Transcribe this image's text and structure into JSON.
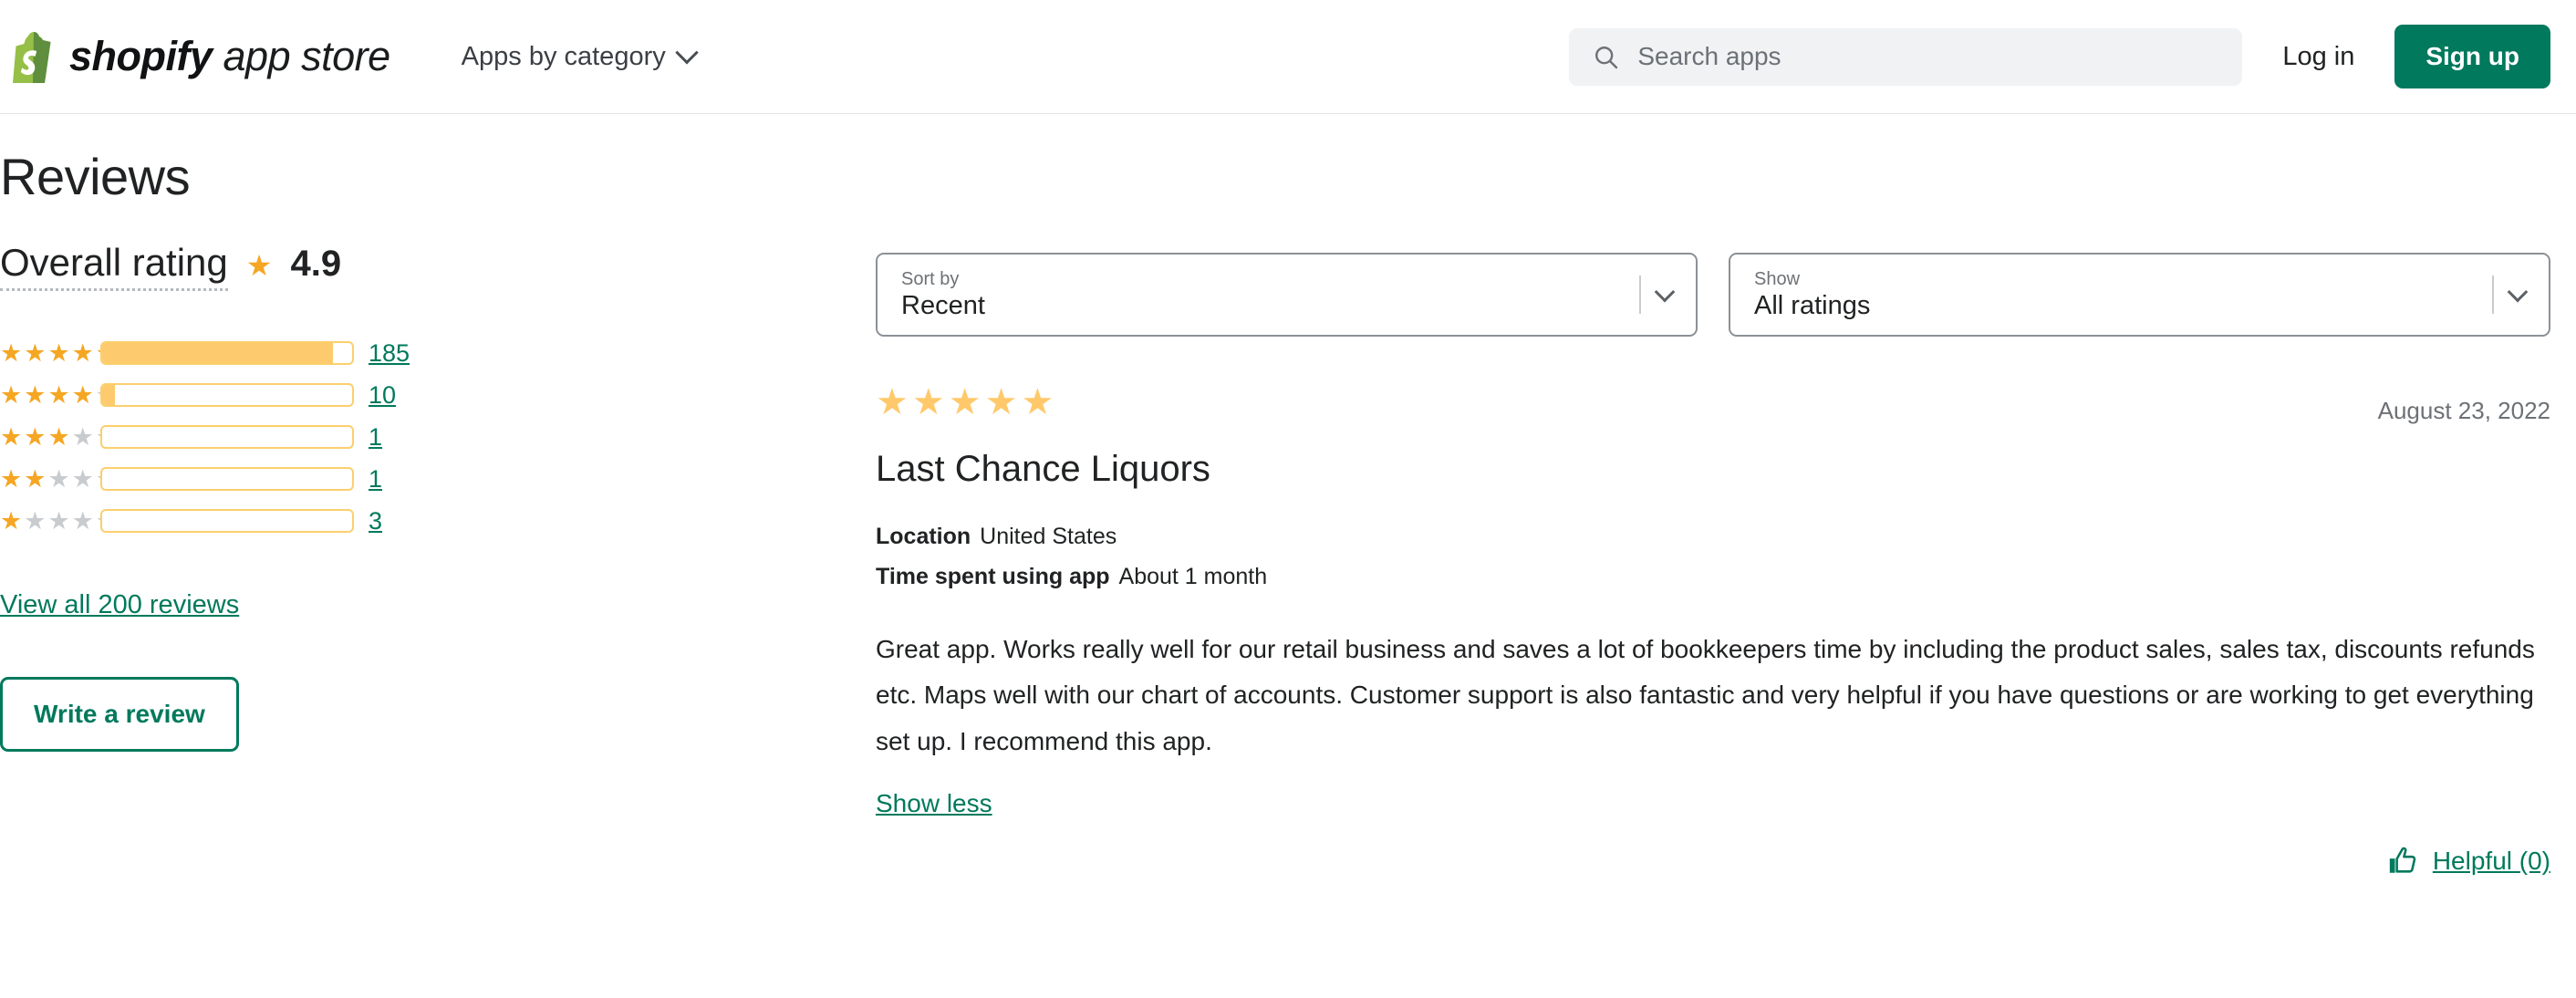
{
  "header": {
    "brand_bold": "shopify",
    "brand_light": " app store",
    "nav_category": "Apps by category",
    "search_placeholder": "Search apps",
    "search_value": "",
    "login": "Log in",
    "signup": "Sign up",
    "brand_green": "#95BF47",
    "accent_green": "#00795c"
  },
  "page_title": "Reviews",
  "overall": {
    "label": "Overall rating",
    "star": "★",
    "value": "4.9"
  },
  "rating_breakdown": [
    {
      "stars": 5,
      "count": "185",
      "fill_percent": 92.5
    },
    {
      "stars": 4,
      "count": "10",
      "fill_percent": 5
    },
    {
      "stars": 3,
      "count": "1",
      "fill_percent": 0
    },
    {
      "stars": 2,
      "count": "1",
      "fill_percent": 0
    },
    {
      "stars": 1,
      "count": "3",
      "fill_percent": 0
    }
  ],
  "view_all_link": "View all 200 reviews",
  "write_review_button": "Write a review",
  "filters": {
    "sort": {
      "label": "Sort by",
      "value": "Recent"
    },
    "show": {
      "label": "Show",
      "value": "All ratings"
    }
  },
  "review": {
    "rating": 5,
    "date": "August 23, 2022",
    "shop_name": "Last Chance Liquors",
    "location_key": "Location",
    "location_value": "United States",
    "time_key": "Time spent using app",
    "time_value": "About 1 month",
    "body": "Great app. Works really well for our retail business and saves a lot of bookkeepers time by including the product sales, sales tax, discounts refunds etc. Maps well with our chart of accounts. Customer support is also fantastic and very helpful if you have questions or are working to get everything set up. I recommend this app.",
    "toggle_link": "Show less",
    "helpful_label": "Helpful (0)"
  },
  "colors": {
    "star_gold": "#f5a623",
    "star_gold_light": "#ffc96b",
    "star_empty": "#c9cccf",
    "bar_fill": "#fdcb6e",
    "bar_border": "#fbcf6d",
    "link_green": "#00795c"
  }
}
